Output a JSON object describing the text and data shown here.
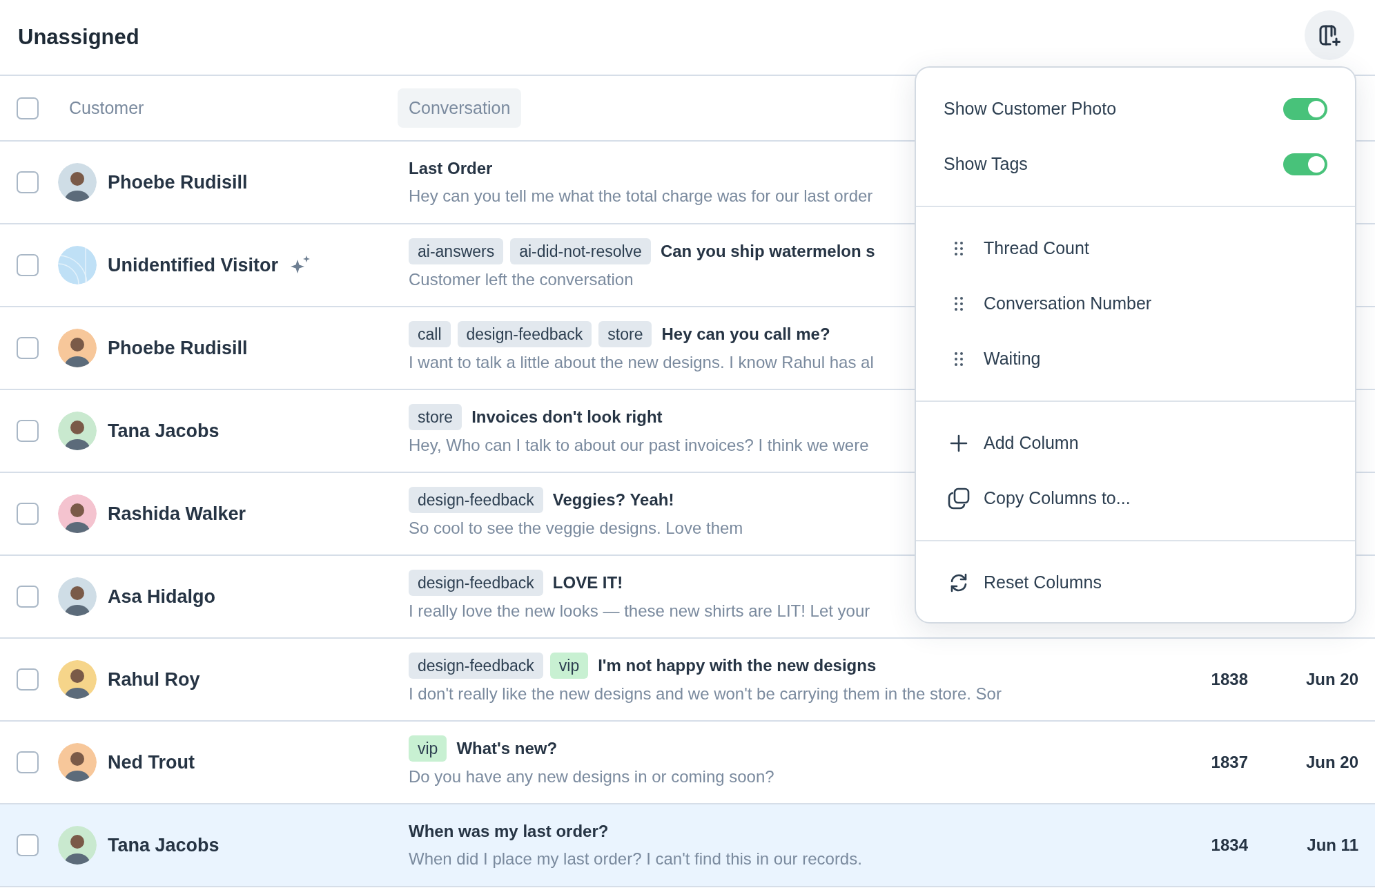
{
  "page": {
    "title": "Unassigned"
  },
  "table": {
    "columns": [
      {
        "label": "Customer",
        "highlighted": false
      },
      {
        "label": "Conversation",
        "highlighted": true
      }
    ],
    "all_checked": false,
    "rows": [
      {
        "customer": "Phoebe Rudisill",
        "visitor": false,
        "ai": false,
        "tags": [],
        "subject": "Last Order",
        "preview": "Hey can you tell me what the total charge was for our last order",
        "checked": false,
        "selected": false
      },
      {
        "customer": "Unidentified Visitor",
        "visitor": true,
        "ai": true,
        "tags": [
          {
            "label": "ai-answers",
            "color": "#e2e8ee"
          },
          {
            "label": "ai-did-not-resolve",
            "color": "#e2e8ee"
          }
        ],
        "subject": "Can you ship watermelon s",
        "preview": "Customer left the conversation",
        "checked": false,
        "selected": false
      },
      {
        "customer": "Phoebe Rudisill",
        "visitor": false,
        "ai": false,
        "tags": [
          {
            "label": "call",
            "color": "#e2e8ee"
          },
          {
            "label": "design-feedback",
            "color": "#e2e8ee"
          },
          {
            "label": "store",
            "color": "#e2e8ee"
          }
        ],
        "subject": "Hey can you call me?",
        "preview": "I want to talk a little about the new designs. I know Rahul has al",
        "checked": false,
        "selected": false
      },
      {
        "customer": "Tana Jacobs",
        "visitor": false,
        "ai": false,
        "tags": [
          {
            "label": "store",
            "color": "#e2e8ee"
          }
        ],
        "subject": "Invoices don't look right",
        "preview": "Hey, Who can I talk to about our past invoices? I think we were",
        "checked": false,
        "selected": false
      },
      {
        "customer": "Rashida Walker",
        "visitor": false,
        "ai": false,
        "tags": [
          {
            "label": "design-feedback",
            "color": "#e2e8ee"
          }
        ],
        "subject": "Veggies? Yeah!",
        "preview": "So cool to see the veggie designs. Love them",
        "checked": false,
        "selected": false
      },
      {
        "customer": "Asa Hidalgo",
        "visitor": false,
        "ai": false,
        "tags": [
          {
            "label": "design-feedback",
            "color": "#e2e8ee"
          }
        ],
        "subject": "LOVE IT!",
        "preview": "I really love the new looks — these new shirts are LIT! Let your",
        "checked": false,
        "selected": false
      },
      {
        "customer": "Rahul Roy",
        "visitor": false,
        "ai": false,
        "tags": [
          {
            "label": "design-feedback",
            "color": "#e2e8ee"
          },
          {
            "label": "vip",
            "color": "#c8f0d2"
          }
        ],
        "subject": "I'm not happy with the new designs",
        "preview": "I don't really like the new designs and we won't be carrying them in the store. Sor",
        "number": "1838",
        "date": "Jun 20",
        "checked": false,
        "selected": false
      },
      {
        "customer": "Ned Trout",
        "visitor": false,
        "ai": false,
        "tags": [
          {
            "label": "vip",
            "color": "#c8f0d2"
          }
        ],
        "subject": "What's new?",
        "preview": "Do you have any new designs in or coming soon?",
        "number": "1837",
        "date": "Jun 20",
        "checked": false,
        "selected": false
      },
      {
        "customer": "Tana Jacobs",
        "visitor": false,
        "ai": false,
        "tags": [],
        "subject": "When was my last order?",
        "preview": "When did I place my last order? I can't find this in our records.",
        "number": "1834",
        "date": "Jun 11",
        "checked": false,
        "selected": true
      }
    ]
  },
  "column_menu": {
    "toggles": [
      {
        "label": "Show Customer Photo",
        "on": true
      },
      {
        "label": "Show Tags",
        "on": true
      }
    ],
    "columns": [
      {
        "label": "Thread Count"
      },
      {
        "label": "Conversation Number"
      },
      {
        "label": "Waiting"
      }
    ],
    "actions": [
      {
        "label": "Add Column",
        "kind": "add"
      },
      {
        "label": "Copy Columns to...",
        "kind": "copy"
      },
      {
        "label": "Reset Columns",
        "kind": "reset"
      }
    ]
  }
}
